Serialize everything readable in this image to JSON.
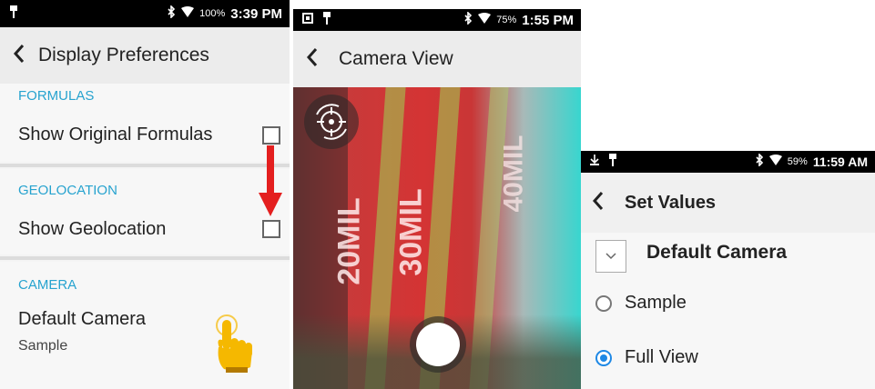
{
  "panels": {
    "display_preferences": {
      "status_bar": {
        "battery": "100%",
        "time": "3:39 PM"
      },
      "title": "Display Preferences",
      "sections": [
        {
          "header": "FORMULAS",
          "item_label": "Show Original Formulas",
          "checked": false
        },
        {
          "header": "GEOLOCATION",
          "item_label": "Show Geolocation",
          "checked": false
        },
        {
          "header": "CAMERA",
          "item_label": "Default Camera",
          "item_summary": "Sample"
        }
      ],
      "annotations": {
        "arrow_color": "#e41f1f",
        "hand_color": "#f5b800"
      }
    },
    "camera_view": {
      "status_bar": {
        "battery": "75%",
        "time": "1:55 PM"
      },
      "title": "Camera View",
      "scene_text": [
        "20MIL",
        "30MIL",
        "40MIL"
      ]
    },
    "set_values": {
      "status_bar": {
        "battery": "59%",
        "time": "11:59 AM"
      },
      "title": "Set Values",
      "dialog_title": "Default Camera",
      "options": [
        {
          "label": "Sample",
          "selected": false
        },
        {
          "label": "Full View",
          "selected": true
        }
      ],
      "accent_color": "#1e88e5"
    }
  },
  "colors": {
    "section_header": "#27a3cf",
    "statusbar": "#000000",
    "appbar": "#ececec"
  }
}
